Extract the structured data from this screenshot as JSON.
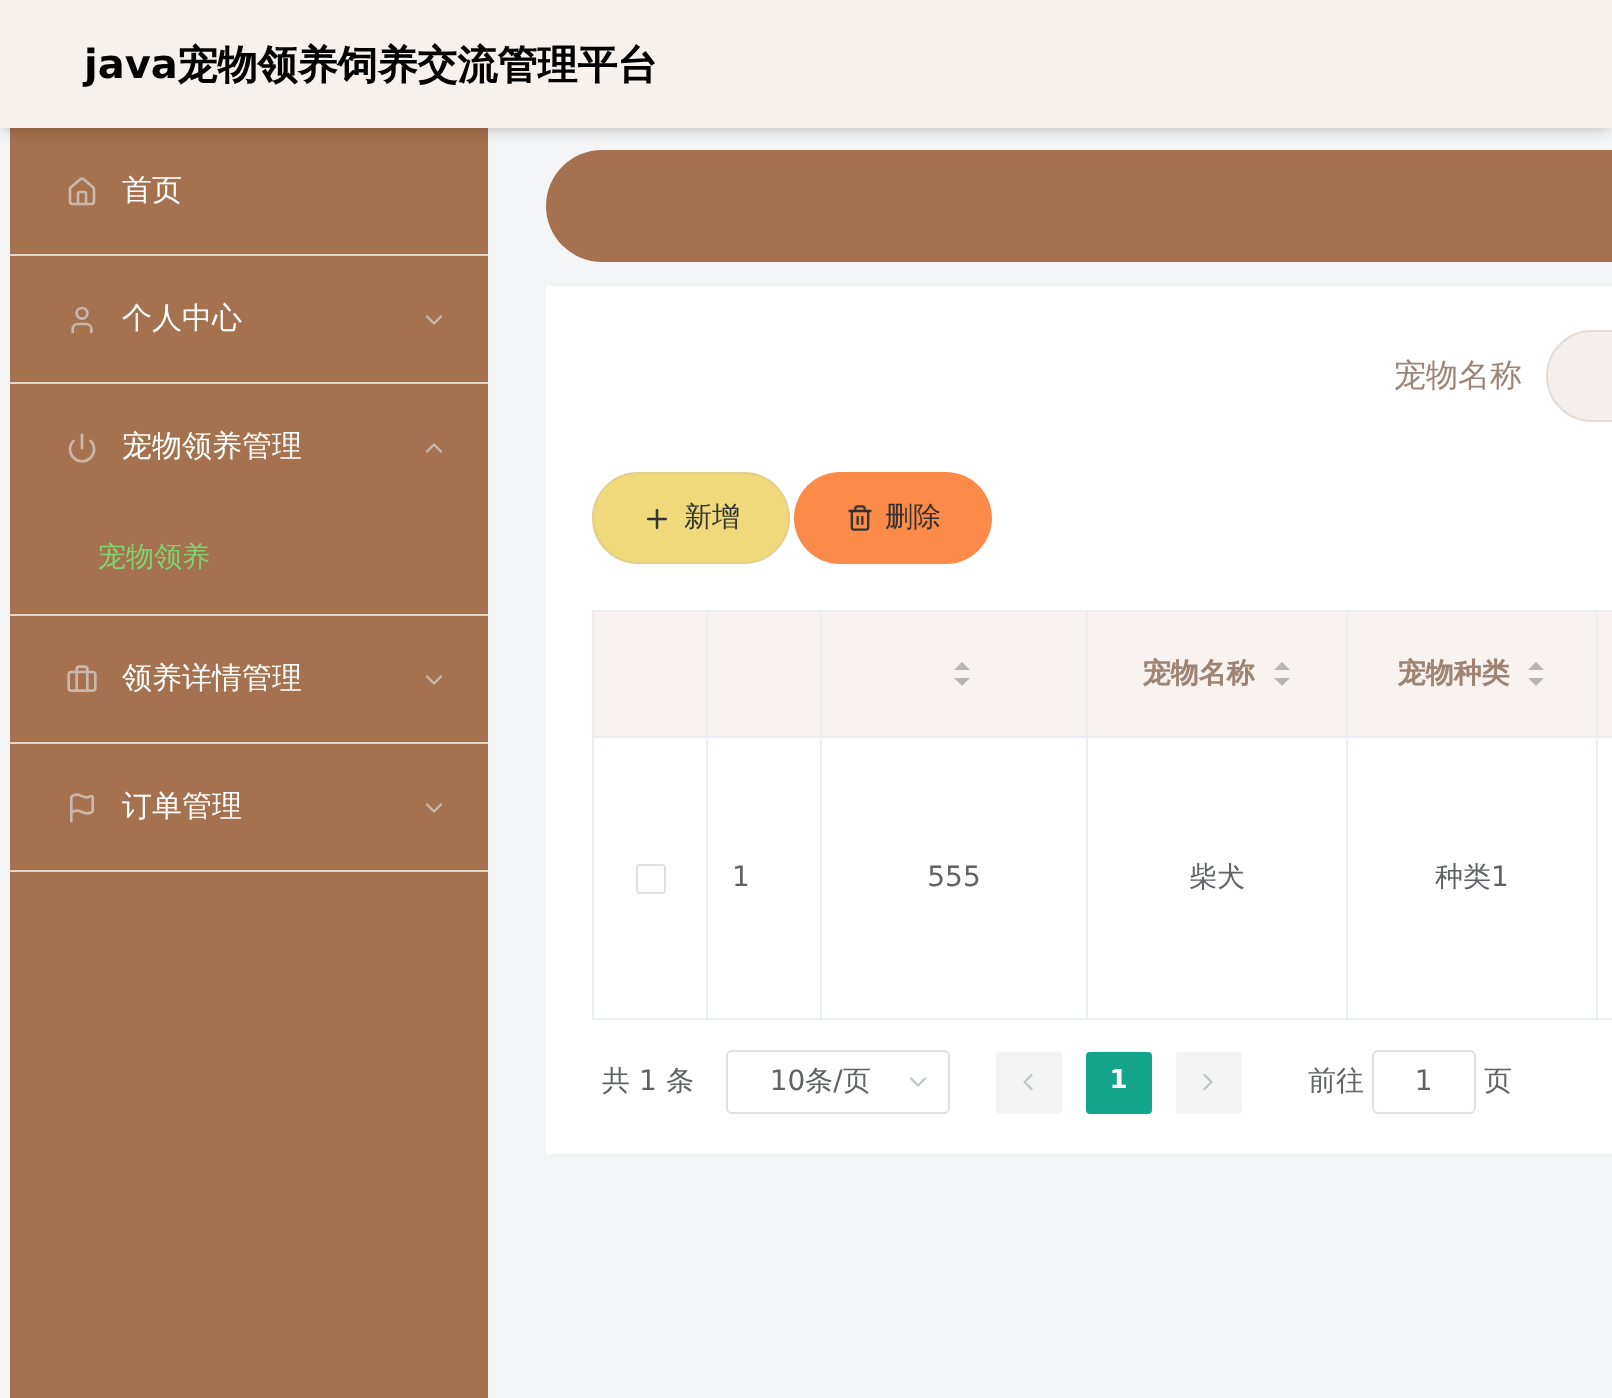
{
  "header": {
    "title": "java宠物领养饲养交流管理平台"
  },
  "sidebar": {
    "items": [
      {
        "label": "首页",
        "kind": "link"
      },
      {
        "label": "个人中心",
        "kind": "menu",
        "expanded": false
      },
      {
        "label": "宠物领养管理",
        "kind": "menu",
        "expanded": true,
        "children": [
          {
            "label": "宠物领养",
            "selected": true
          }
        ]
      },
      {
        "label": "领养详情管理",
        "kind": "menu",
        "expanded": false
      },
      {
        "label": "订单管理",
        "kind": "menu",
        "expanded": false
      }
    ]
  },
  "search": {
    "label": "宠物名称"
  },
  "buttons": [
    {
      "label": "新增",
      "kind": "add"
    },
    {
      "label": "删除",
      "kind": "delete"
    }
  ],
  "table": {
    "columns": [
      {
        "kind": "checkbox"
      },
      {
        "kind": "index"
      },
      {
        "kind": "sortable"
      },
      {
        "kind": "sortable",
        "label": "宠物名称"
      },
      {
        "kind": "sortable",
        "label": "宠物种类"
      },
      {
        "kind": "blank"
      }
    ],
    "rows": [
      {
        "checked": false,
        "cells": [
          "",
          "1",
          "555",
          "柴犬",
          "种类1"
        ]
      }
    ]
  },
  "pagination": {
    "total": "共 1 条",
    "page_size": "10条/页",
    "pages": [
      {
        "label": "1",
        "selected": true
      }
    ],
    "goto_label": "前往",
    "goto_value": "1",
    "goto_suffix": "页"
  }
}
